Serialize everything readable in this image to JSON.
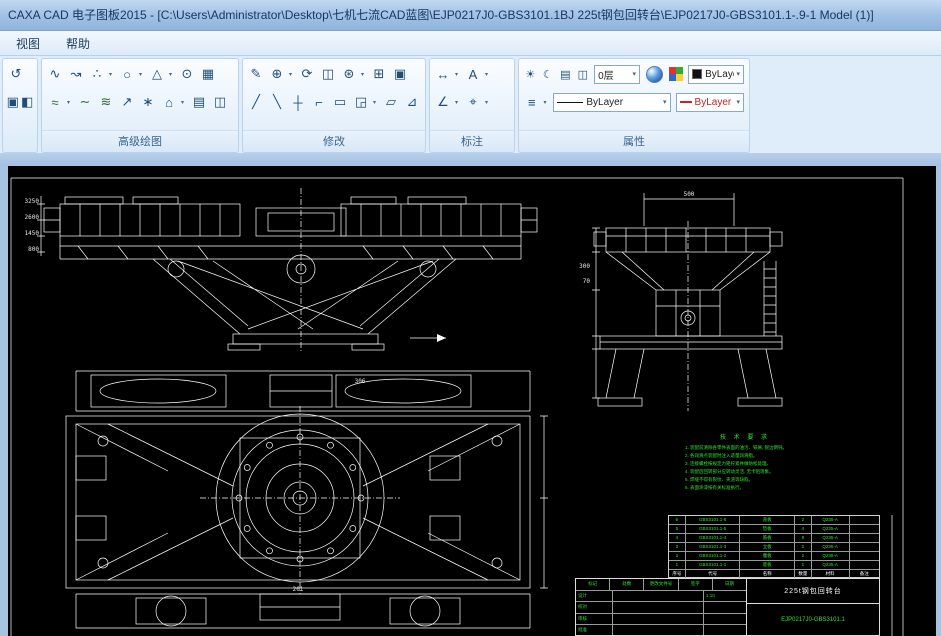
{
  "window": {
    "title": "CAXA CAD 电子图板2015 - [C:\\Users\\Administrator\\Desktop\\七机七流CAD蓝图\\EJP0217J0-GBS3101.1BJ 225t钢包回转台\\EJP0217J0-GBS3101.1-.9-1 Model (1)]"
  },
  "menu": {
    "view": "视图",
    "help": "帮助"
  },
  "ribbon": {
    "caret": "▾",
    "mini": {
      "undo": "↺",
      "paste": "▣",
      "copy": "◧"
    },
    "group_labels": {
      "draw": "高级绘图",
      "modify": "修改",
      "dim": "标注",
      "props": "属性"
    },
    "draw_row1": [
      "∿",
      "↝",
      "∴",
      "○",
      "△",
      "⊙",
      "▦"
    ],
    "draw_row2": [
      "≈",
      "∼",
      "≋",
      "↗",
      "∗",
      "⌂",
      "▤",
      "◫"
    ],
    "modify_row1": [
      "✎",
      "⊕",
      "⟳",
      "◫",
      "⊛",
      "⊞",
      "▣"
    ],
    "modify_row2": [
      "╱",
      "╲",
      "┼",
      "⌐",
      "▭",
      "◲",
      "▱",
      "⊿"
    ],
    "dim_row1": [
      "↔",
      "A"
    ],
    "dim_row2": [
      "∠",
      "⌖"
    ],
    "props_icons": [
      "☀",
      "☾",
      "▤",
      "◫"
    ],
    "linetype_icon": "≡",
    "layer_select": "0层",
    "color_select": "ByLayer",
    "linetype_select": "ByLayer",
    "lineweight_select": "ByLayer"
  },
  "colors": {
    "canvas_background": "#000000",
    "canvas_line": "#ffffff",
    "notes_green": "#2ee52e",
    "titlebar_text": "#17355e",
    "accent_red": "#cc2222"
  },
  "drawing": {
    "labels": {
      "dim_left_1": "3250",
      "dim_left_2": "2600",
      "dim_left_3": "1450",
      "dim_left_4": "800",
      "dim_500": "500",
      "dim_300": "300",
      "dim_70": "70",
      "dim_306": "306",
      "dim_201": "201"
    },
    "notes": {
      "title": "技 术 要 求",
      "lines": [
        "1. 装配前清除各零件表面的油污、铁屑, 锐边倒钝。",
        "2. 各润滑点装配时注入适量润滑脂。",
        "3. 连接螺栓按规定力矩拧紧并做防松处理。",
        "4. 装配后回转部分应转动灵活, 无卡阻现象。",
        "5. 焊缝不得有裂纹、夹渣等缺陷。",
        "6. 表面涂漆按有关标准执行。"
      ]
    },
    "parts_table": {
      "headers": [
        "序号",
        "代号",
        "名称",
        "数量",
        "材料",
        "备注"
      ],
      "rows": [
        [
          "6",
          "GBS3101.1-6",
          "盖板",
          "2",
          "Q235-A",
          ""
        ],
        [
          "5",
          "GBS3101.1-5",
          "垫板",
          "4",
          "Q235-A",
          ""
        ],
        [
          "4",
          "GBS3101.1-4",
          "筋板",
          "8",
          "Q235-A",
          ""
        ],
        [
          "3",
          "GBS3101.1-3",
          "立板",
          "2",
          "Q235-A",
          ""
        ],
        [
          "2",
          "GBS3101.1-2",
          "腹板",
          "2",
          "Q235-A",
          ""
        ],
        [
          "1",
          "GBS3101.1-1",
          "底板",
          "1",
          "Q235-A",
          ""
        ]
      ]
    },
    "title_block": {
      "name": "225t钢包回转台",
      "drawing_no": "EJP0217J0-GBS3101.1",
      "scale": "1:10",
      "sign_labels": [
        "设计",
        "校对",
        "审核",
        "批准"
      ],
      "change_labels": [
        "标记",
        "处数",
        "更改文件号",
        "签字",
        "日期"
      ]
    }
  }
}
